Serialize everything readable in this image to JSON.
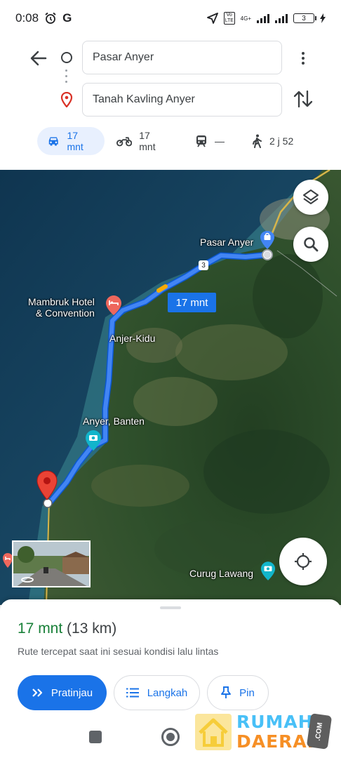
{
  "status_bar": {
    "time": "0:08",
    "google_letter": "G",
    "network": "4G+",
    "volte": "Vo LTE",
    "battery": "3"
  },
  "directions": {
    "origin": "Pasar Anyer",
    "destination": "Tanah Kavling Anyer",
    "modes": [
      {
        "name": "car",
        "label": "17 mnt",
        "active": true
      },
      {
        "name": "motorcycle",
        "label": "17 mnt",
        "active": false
      },
      {
        "name": "transit",
        "label": "—",
        "active": false
      },
      {
        "name": "walk",
        "label": "2 j 52",
        "active": false
      }
    ]
  },
  "map": {
    "labels": {
      "pasar_anyer": "Pasar Anyer",
      "mambruk_line1": "Mambruk Hotel",
      "mambruk_line2": "& Convention",
      "anjer_kidu": "Anjer-Kidu",
      "anyer_banten": "Anyer, Banten",
      "curug_lawang": "Curug Lawang",
      "road_number": "3"
    },
    "route_time": "17 mnt",
    "colors": {
      "route": "#1a73e8",
      "route_outline": "#0b57d0",
      "pin_red": "#ea4335",
      "attraction_teal": "#12b5cb"
    }
  },
  "sheet": {
    "time": "17 mnt",
    "distance": "(13 km)",
    "subtitle": "Rute tercepat saat ini sesuai kondisi lalu lintas",
    "buttons": {
      "preview": "Pratinjau",
      "steps": "Langkah",
      "pin": "Pin"
    }
  },
  "watermark": {
    "line1": "RUMAH",
    "line2": "DAERAH",
    "suffix": ".COM"
  }
}
